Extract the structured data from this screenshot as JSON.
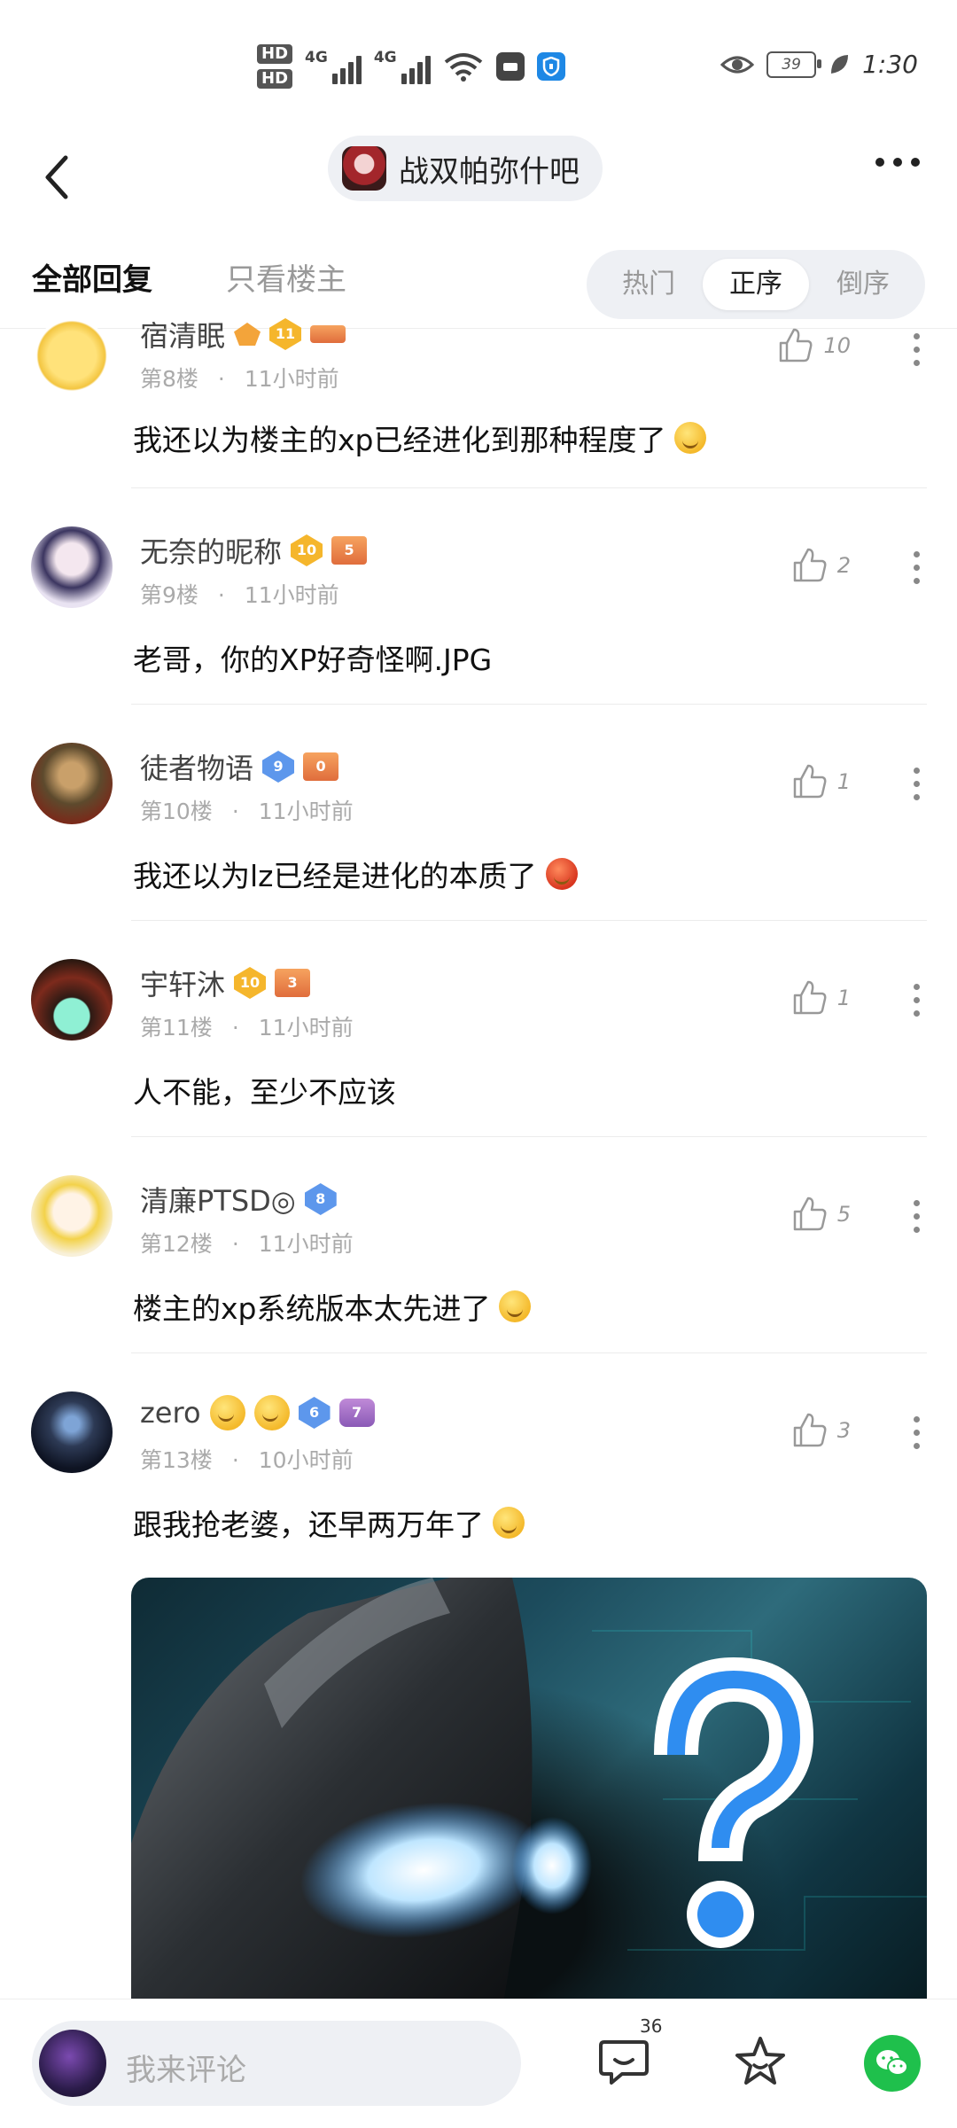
{
  "status_bar": {
    "hd1": "HD",
    "hd2": "HD",
    "sig1": "4G",
    "sig2": "4G",
    "battery": "39",
    "time": "1:30"
  },
  "header": {
    "forum_name": "战双帕弥什吧"
  },
  "tabs": {
    "all_replies": "全部回复",
    "only_op": "只看楼主",
    "sort_hot": "热门",
    "sort_asc": "正序",
    "sort_desc": "倒序"
  },
  "comments": [
    {
      "user": "宿清眠",
      "level": "11",
      "floor": "第8楼",
      "time": "11小时前",
      "likes": "10",
      "text": "我还以为楼主的xp已经进化到那种程度了"
    },
    {
      "user": "无奈的昵称",
      "level": "10",
      "rank": "5",
      "floor": "第9楼",
      "time": "11小时前",
      "likes": "2",
      "text": "老哥，你的XP好奇怪啊.JPG"
    },
    {
      "user": "徒者物语",
      "level": "9",
      "rank": "0",
      "floor": "第10楼",
      "time": "11小时前",
      "likes": "1",
      "text": "我还以为lz已经是进化的本质了"
    },
    {
      "user": "宇轩沐",
      "level": "10",
      "rank": "3",
      "floor": "第11楼",
      "time": "11小时前",
      "likes": "1",
      "text": "人不能，至少不应该"
    },
    {
      "user": "清廉PTSD◎",
      "level": "8",
      "floor": "第12楼",
      "time": "11小时前",
      "likes": "5",
      "text": "楼主的xp系统版本太先进了"
    },
    {
      "user": "zero",
      "level": "6",
      "rank": "7",
      "floor": "第13楼",
      "time": "10小时前",
      "likes": "3",
      "text": "跟我抢老婆，还早两万年了"
    }
  ],
  "bottom_bar": {
    "comment_placeholder": "我来评论",
    "comment_count": "36"
  },
  "colors": {
    "accent_blue": "#5d97ec",
    "gold": "#f5b62c",
    "wechat_green": "#1fc04c"
  }
}
